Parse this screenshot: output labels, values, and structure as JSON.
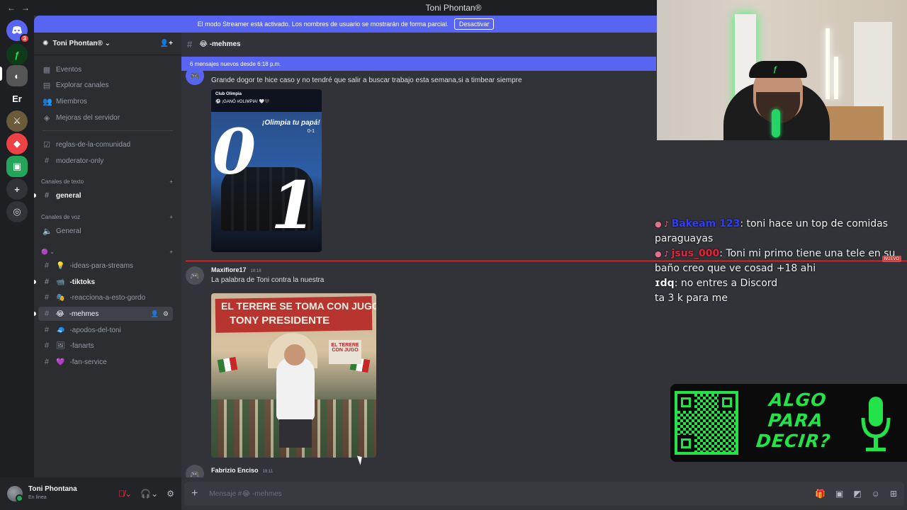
{
  "window": {
    "title": "Toni Phontan®",
    "back": "←",
    "forward": "→"
  },
  "rail": {
    "badge_count": "3",
    "server_er": "Er"
  },
  "banner": {
    "text": "El modo Streamer está activado. Los nombres de usuario se mostrarán de forma parcial.",
    "button": "Desactivar"
  },
  "guild": {
    "name": "Toni Phontan® ⌄"
  },
  "sidebar": {
    "top_items": [
      {
        "label": "Eventos",
        "icon": "calendar-icon"
      },
      {
        "label": "Explorar canales",
        "icon": "browse-icon"
      },
      {
        "label": "Miembros",
        "icon": "members-icon"
      },
      {
        "label": "Mejoras del servidor",
        "icon": "boost-icon"
      }
    ],
    "pinned": [
      "reglas-de-la-comunidad",
      "moderator-only"
    ],
    "cat_text": "Canales de texto",
    "general": "general",
    "cat_voice": "Canales de voz",
    "voice_general": "General",
    "cat_custom": "⌄",
    "channels": [
      {
        "label": "-ideas-para-streams",
        "emoji": "💡"
      },
      {
        "label": "-tiktoks",
        "emoji": "📹"
      },
      {
        "label": "-reacciona-a-esto-gordo",
        "emoji": "🎭"
      },
      {
        "label": "-mehmes",
        "emoji": "😂"
      },
      {
        "label": "-apodos-del-toni",
        "emoji": "🧢"
      },
      {
        "label": "-fanarts",
        "emoji": "🖼"
      },
      {
        "label": "-fan-service",
        "emoji": "💜"
      }
    ]
  },
  "user": {
    "name": "Toni Phontana",
    "status": "En línea"
  },
  "channel": {
    "name": "😂 -mehmes",
    "new_messages": "6 mensajes nuevos desde 6:18 p.m."
  },
  "messages": [
    {
      "text": "Grande dogor te hice caso y no tendré que salir a buscar trabajo esta semana,si a timbear siempre",
      "image": {
        "club": "Club Olimpia",
        "caption": "⚽ ¡GANÓ #OLIMPIA! 🤍🖤",
        "tag": "¡Olimpia tu papá!",
        "score": "0-1",
        "big_left": "0",
        "big_right": "1"
      }
    },
    {
      "author": "Maxifiore17",
      "time": "18:18",
      "text": "La palabra de Toni contra la nuestra",
      "image": {
        "line1": "EL TERERE SE TOMA CON JUGO",
        "line2": "TONY PRESIDENTE",
        "sign": "EL TERERE CON JUGO"
      }
    },
    {
      "author": "Fabrizio Enciso",
      "time": "19:11"
    }
  ],
  "overlay": {
    "lines": [
      {
        "user": "Bakeam 123",
        "text": ": toni hace un top de comidas paraguayas"
      },
      {
        "user": "jsus_000",
        "text": ": Toni mi primo tiene una tele en su baño creo que ve cosad +18 ahi"
      },
      {
        "user": "ɪdq",
        "text": ": no entres a Discord"
      },
      {
        "user": "",
        "text": "ta 3 k para me"
      }
    ],
    "nuevo": "NUEVO"
  },
  "promo": {
    "text": "ALGO PARA DECIR?",
    "accent": "#23e24a"
  },
  "composer": {
    "placeholder": "Mensaje #😂 -mehmes"
  },
  "colors": {
    "blurple": "#5865f2",
    "red": "#f23f43",
    "green": "#23a55a"
  }
}
